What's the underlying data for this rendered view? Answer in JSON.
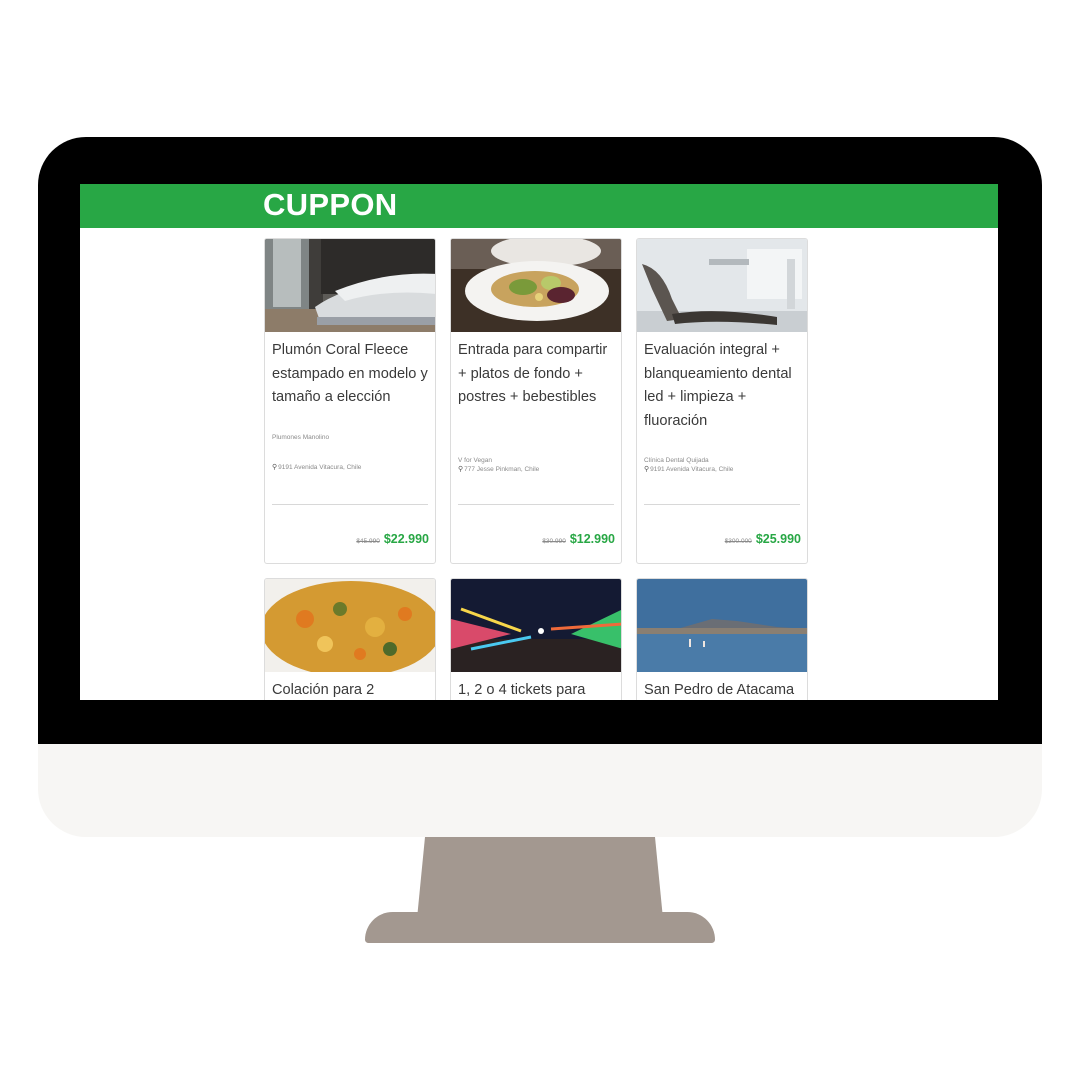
{
  "navbar": {
    "brand": "CUPPON",
    "color": "#28a745"
  },
  "deals": [
    {
      "title": "Plumón Coral Fleece estampado en modelo y tamaño a elección",
      "merchant": "Plumones Manolino",
      "address": "9191 Avenida Vitacura, Chile",
      "old_price": "$45.990",
      "price": "$22.990",
      "image": "bedroom-photo"
    },
    {
      "title": "Entrada para compartir + platos de fondo + postres + bebestibles",
      "merchant": "V for Vegan",
      "address": "777 Jesse Pinkman, Chile",
      "old_price": "$30.990",
      "price": "$12.990",
      "image": "salad-plate-photo"
    },
    {
      "title": "Evaluación integral + blanqueamiento dental led + limpieza + fluoración",
      "merchant": "Clínica Dental Quijada",
      "address": "9191 Avenida Vitacura, Chile",
      "old_price": "$300.000",
      "price": "$25.990",
      "image": "dental-chair-photo"
    },
    {
      "title": "Colación para 2",
      "image": "food-bowl-photo"
    },
    {
      "title": "1, 2 o 4 tickets para",
      "image": "carnival-night-photo"
    },
    {
      "title": "San Pedro de Atacama",
      "image": "salt-lake-photo"
    }
  ],
  "icons": {
    "location": "map-marker-icon"
  }
}
